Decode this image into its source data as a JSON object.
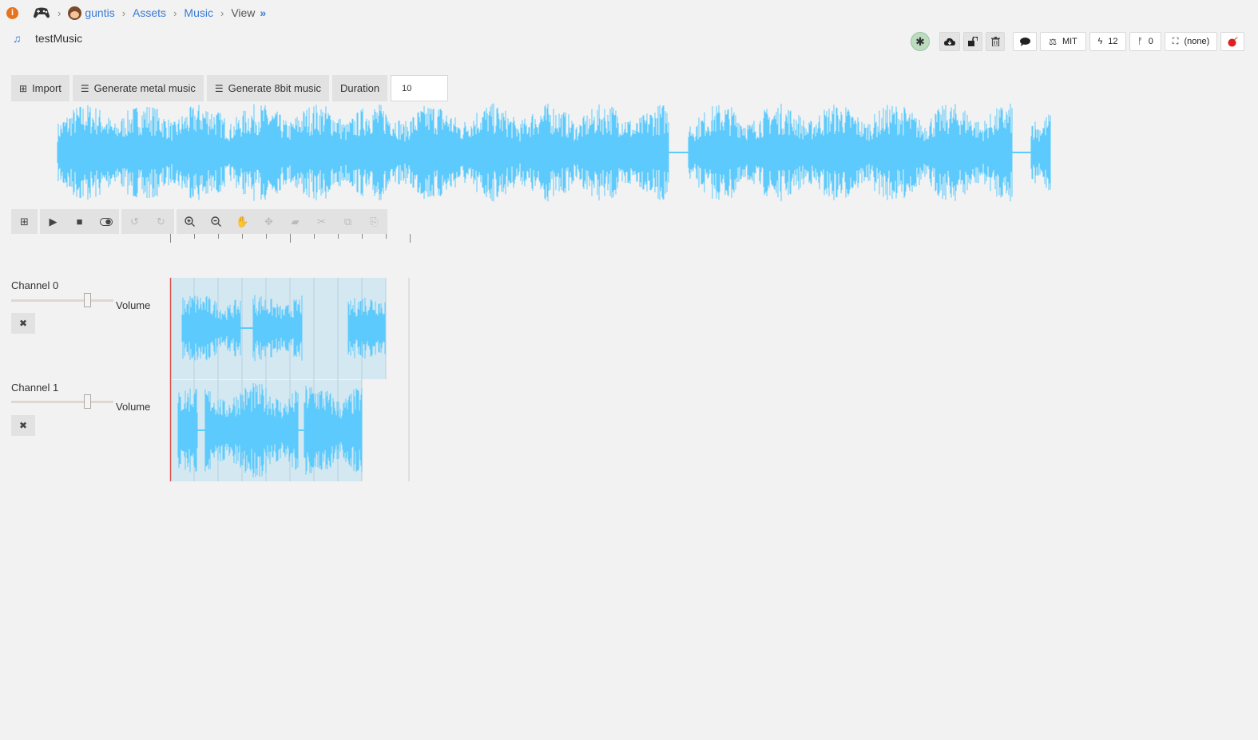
{
  "breadcrumb": {
    "user": "guntis",
    "assets": "Assets",
    "music": "Music",
    "view": "View",
    "more": "»"
  },
  "asset": {
    "title": "testMusic"
  },
  "toolbar": {
    "license": "MIT",
    "stars": "12",
    "forks": "0",
    "project": "(none)"
  },
  "controls": {
    "import": "Import",
    "generate_metal": "Generate metal music",
    "generate_8bit": "Generate 8bit music",
    "duration_label": "Duration",
    "duration_value": "10"
  },
  "channels": [
    {
      "name": "Channel 0",
      "volume_label": "Volume",
      "volume": 0.74
    },
    {
      "name": "Channel 1",
      "volume_label": "Volume",
      "volume": 0.74
    }
  ],
  "colors": {
    "wave": "#5ccafc",
    "playhead": "#d9534f",
    "clip_bg": "#d4e8f2"
  }
}
